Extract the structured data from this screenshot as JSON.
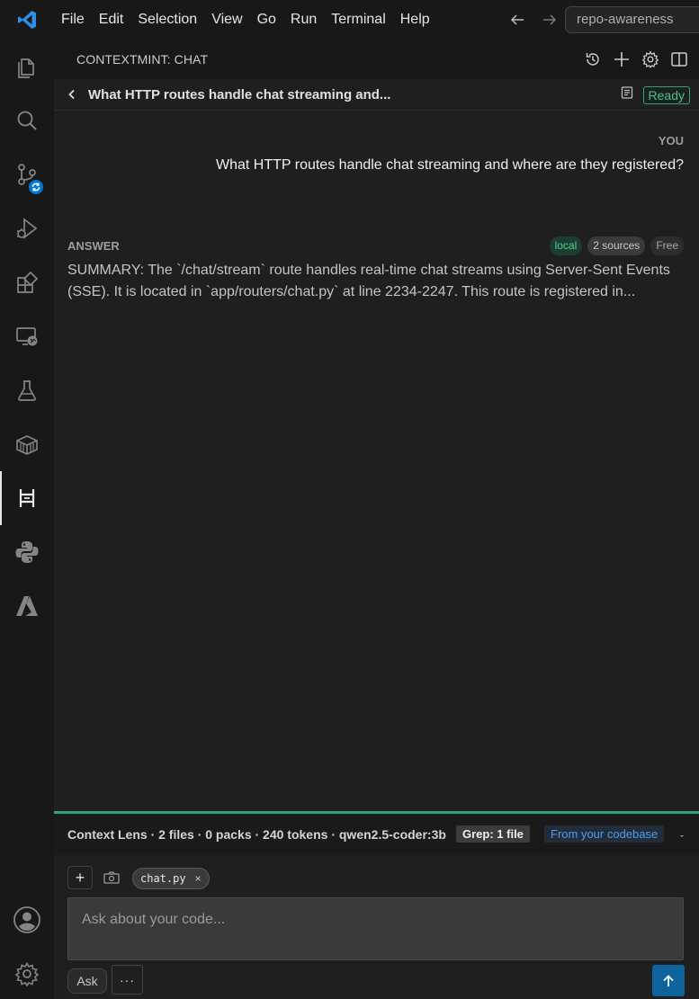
{
  "titlebar": {
    "menu": [
      "File",
      "Edit",
      "Selection",
      "View",
      "Go",
      "Run",
      "Terminal",
      "Help"
    ],
    "search_text": "repo-awareness",
    "icons": [
      "vscode-logo-icon",
      "arrow-left-icon",
      "arrow-right-icon"
    ]
  },
  "activitybar": {
    "items": [
      "explorer-icon",
      "search-icon",
      "source-control-icon",
      "run-debug-icon",
      "extensions-icon",
      "remote-explorer-icon",
      "testing-icon",
      "containers-icon",
      "contextmint-icon",
      "python-icon",
      "azure-icon"
    ],
    "bottom": [
      "accounts-icon",
      "manage-icon"
    ],
    "active": "contextmint-icon"
  },
  "panel": {
    "title": "CONTEXTMINT: CHAT",
    "actions": [
      "history-icon",
      "new-chat-icon",
      "settings-icon",
      "split-icon"
    ]
  },
  "chat": {
    "title": "What HTTP routes handle chat streaming and...",
    "status": "Ready",
    "you_label": "YOU",
    "question": "What HTTP routes handle chat streaming and where are they registered?",
    "answer_label": "ANSWER",
    "tags": {
      "local": "local",
      "sources": "2 sources",
      "free": "Free"
    },
    "answer": "SUMMARY: The `/chat/stream` route handles real-time chat streams using Server-Sent Events (SSE). It is located in `app/routers/chat.py` at line 2234-2247. This route is registered in..."
  },
  "context_lens": {
    "summary": "Context Lens · 2 files · 0 packs · 240 tokens · qwen2.5-coder:3b",
    "grep": "Grep: 1 file",
    "source": "From your codebase"
  },
  "composer": {
    "add_label": "+",
    "chip_label": "chat.py",
    "chip_close": "×",
    "placeholder": "Ask about your code...",
    "mode": "Ask",
    "more": "···"
  },
  "colors": {
    "accent": "#0078d4",
    "ready": "#3fc88a",
    "lens_line": "#2ea57a",
    "send": "#0e639c"
  }
}
